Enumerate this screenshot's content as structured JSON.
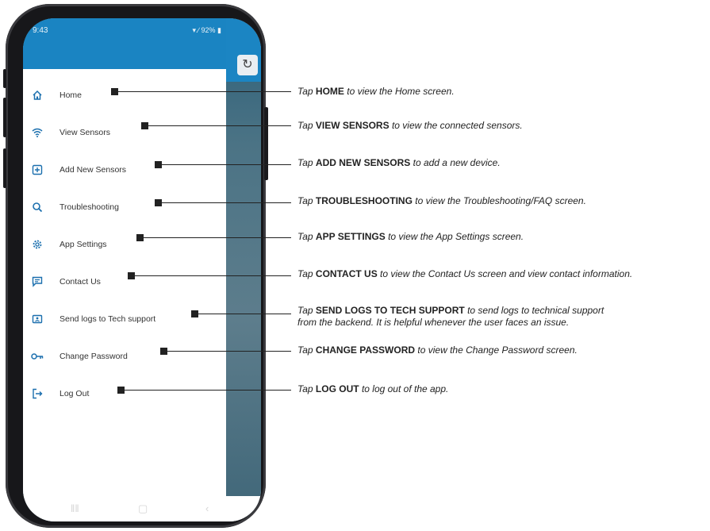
{
  "status_bar": {
    "time": "9:43",
    "battery": "92%"
  },
  "menu": [
    {
      "label": "Home",
      "icon": "home-icon",
      "desc_prefix": "Tap",
      "desc_bold": "HOME",
      "desc_rest": "to view the Home screen."
    },
    {
      "label": "View Sensors",
      "icon": "wifi-icon",
      "desc_prefix": "Tap",
      "desc_bold": "VIEW SENSORS",
      "desc_rest": "to view the connected sensors."
    },
    {
      "label": "Add New Sensors",
      "icon": "plus-square-icon",
      "desc_prefix": "Tap",
      "desc_bold": "ADD NEW SENSORS",
      "desc_rest": "to add a new device."
    },
    {
      "label": "Troubleshooting",
      "icon": "search-icon",
      "desc_prefix": "Tap",
      "desc_bold": "TROUBLESHOOTING",
      "desc_rest": "to view the Troubleshooting/FAQ screen."
    },
    {
      "label": "App Settings",
      "icon": "gear-icon",
      "desc_prefix": "Tap",
      "desc_bold": "APP SETTINGS",
      "desc_rest": "to view the App Settings screen."
    },
    {
      "label": "Contact Us",
      "icon": "chat-icon",
      "desc_prefix": "Tap",
      "desc_bold": "CONTACT US",
      "desc_rest": "to view the Contact Us screen and view contact information."
    },
    {
      "label": "Send logs to Tech support",
      "icon": "folder-user-icon",
      "desc_prefix": "Tap",
      "desc_bold": "SEND LOGS TO TECH SUPPORT",
      "desc_rest": "to send logs to technical support",
      "desc_line2": "from the backend. It is helpful whenever the user faces an issue."
    },
    {
      "label": "Change Password",
      "icon": "key-icon",
      "desc_prefix": "Tap",
      "desc_bold": "CHANGE PASSWORD",
      "desc_rest": "to view the Change Password screen."
    },
    {
      "label": "Log Out",
      "icon": "logout-icon",
      "desc_prefix": "Tap",
      "desc_bold": "LOG OUT",
      "desc_rest": "to log out of the app."
    }
  ],
  "app_header": {
    "refresh_icon": "refresh-icon"
  }
}
